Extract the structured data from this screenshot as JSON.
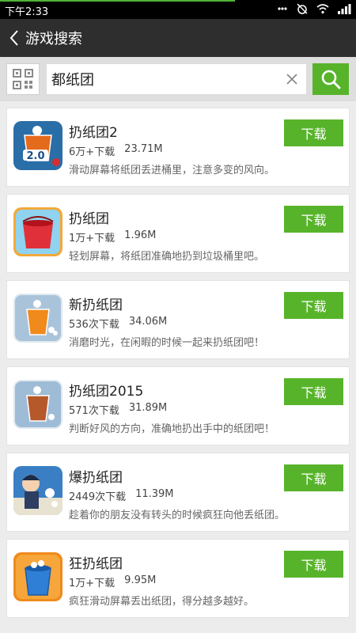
{
  "status_bar": {
    "time": "下午2:33",
    "download_progress": 0.66
  },
  "header": {
    "back_icon": "chevron-left-icon",
    "title": "游戏搜索"
  },
  "search": {
    "query": "都纸团",
    "qr_icon": "qr-code-icon",
    "clear_icon": "close-icon",
    "search_icon": "search-icon"
  },
  "colors": {
    "accent": "#57b42a",
    "header_bg": "#2e2e2e",
    "status_bg": "#000000",
    "page_bg": "#ececec"
  },
  "results": [
    {
      "name": "扔纸团2",
      "downloads": "6万+下载",
      "size": "23.71M",
      "desc": "滑动屏幕将纸团丢进桶里，注意多变的风向。",
      "button": "下载",
      "icon": "paper-toss-2-icon"
    },
    {
      "name": "扔纸团",
      "downloads": "1万+下载",
      "size": "1.96M",
      "desc": "轻划屏幕，将纸团准确地扔到垃圾桶里吧。",
      "button": "下载",
      "icon": "red-bucket-icon"
    },
    {
      "name": "新扔纸团",
      "downloads": "536次下载",
      "size": "34.06M",
      "desc": "消磨时光，在闲暇的时候一起来扔纸团吧！",
      "button": "下载",
      "icon": "orange-cup-icon"
    },
    {
      "name": "扔纸团2015",
      "downloads": "571次下载",
      "size": "31.89M",
      "desc": "判断好风的方向，准确地扔出手中的纸团吧！",
      "button": "下载",
      "icon": "brown-cup-icon"
    },
    {
      "name": "爆扔纸团",
      "downloads": "2449次下载",
      "size": "11.39M",
      "desc": "趁着你的朋友没有转头的时候疯狂向他丢纸团。",
      "button": "下载",
      "icon": "cartoon-man-icon"
    },
    {
      "name": "狂扔纸团",
      "downloads": "1万+下载",
      "size": "9.95M",
      "desc": "疯狂滑动屏幕丢出纸团，得分越多越好。",
      "button": "下载",
      "icon": "blue-bin-icon"
    }
  ]
}
